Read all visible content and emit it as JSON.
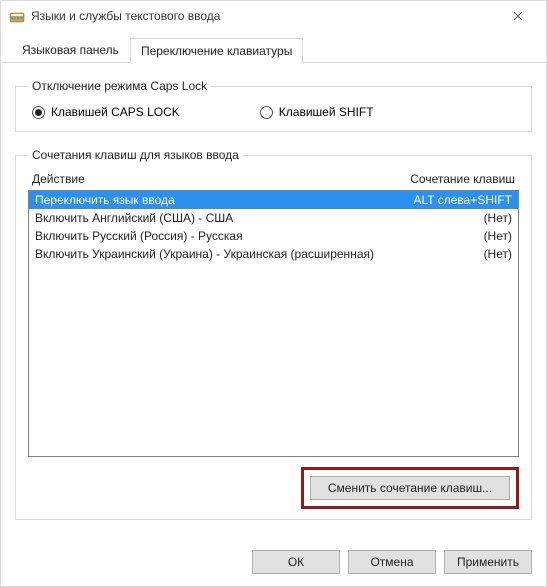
{
  "titlebar": {
    "title": "Языки и службы текстового ввода"
  },
  "tabs": {
    "lang_panel": "Языковая панель",
    "switch_kb": "Переключение клавиатуры"
  },
  "capslock_group": {
    "legend": "Отключение режима Caps Lock",
    "opt_caps": "Клавишей CAPS LOCK",
    "opt_shift": "Клавишей SHIFT"
  },
  "hotkeys_group": {
    "legend": "Сочетания клавиш для языков ввода",
    "header_action": "Действие",
    "header_combo": "Сочетание клавиш",
    "rows": [
      {
        "action": "Переключить язык ввода",
        "combo": "ALT слева+SHIFT"
      },
      {
        "action": "Включить Английский (США) - США",
        "combo": "(Нет)"
      },
      {
        "action": "Включить Русский (Россия) - Русская",
        "combo": "(Нет)"
      },
      {
        "action": "Включить Украинский (Украина) - Украинская (расширенная)",
        "combo": "(Нет)"
      }
    ],
    "change_btn": "Сменить сочетание клавиш..."
  },
  "footer": {
    "ok": "ОК",
    "cancel": "Отмена",
    "apply": "Применить"
  }
}
